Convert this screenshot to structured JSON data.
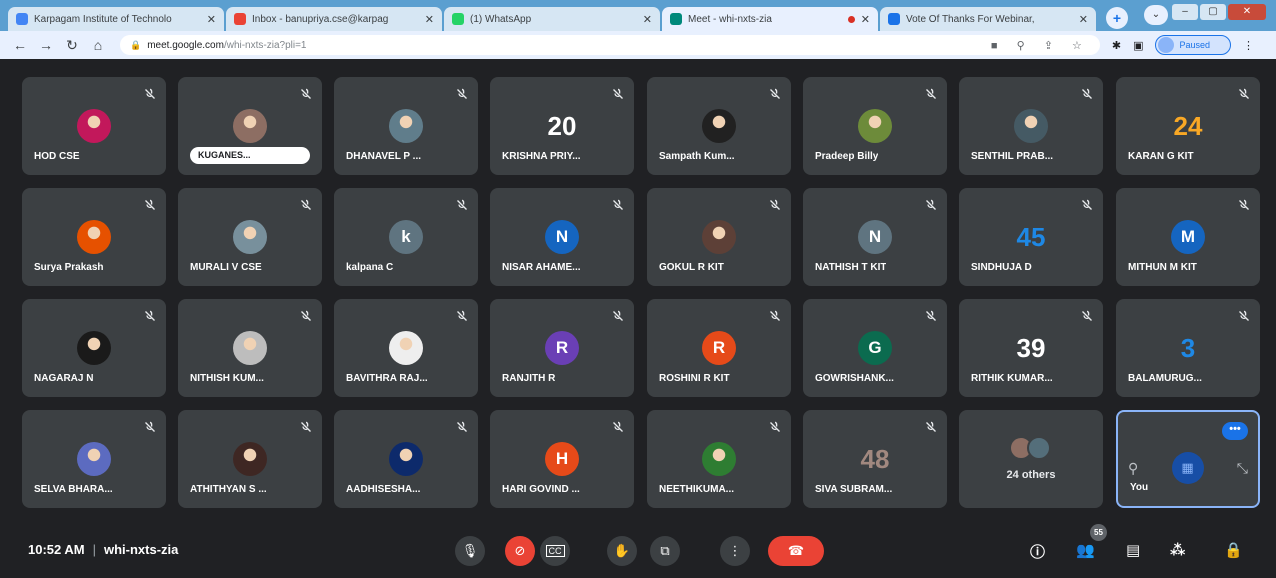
{
  "browser": {
    "tabs": [
      {
        "title": "Karpagam Institute of Technolo",
        "color": "#4285f4",
        "active": false
      },
      {
        "title": "Inbox - banupriya.cse@karpag",
        "color": "#ea4335",
        "active": false
      },
      {
        "title": "(1) WhatsApp",
        "color": "#25d366",
        "active": false
      },
      {
        "title": "Meet - whi-nxts-zia",
        "color": "#00897b",
        "active": true
      },
      {
        "title": "Vote Of Thanks For Webinar, ",
        "color": "#1a73e8",
        "active": false
      }
    ],
    "new_tab": "+",
    "tab_dropdown": "⌄",
    "url_host": "meet.google.com",
    "url_path": "/whi-nxts-zia?pli=1",
    "profile_status": "Paused"
  },
  "meeting": {
    "time": "10:52 AM",
    "code": "whi-nxts-zia",
    "participant_count": "55",
    "others_label": "24 others",
    "self_label": "You"
  },
  "participants": [
    {
      "name": "HOD CSE",
      "avatar": "photo",
      "color": "#c2185b"
    },
    {
      "name": "KUGANES...",
      "avatar": "photo",
      "color": "#8d6e63",
      "pill": true
    },
    {
      "name": "DHANAVEL P ...",
      "avatar": "photo",
      "color": "#607d8b"
    },
    {
      "name": "KRISHNA PRIY...",
      "avatar": "20",
      "color": "#ffffff"
    },
    {
      "name": "Sampath Kum...",
      "avatar": "photo",
      "color": "#212121"
    },
    {
      "name": "Pradeep Billy",
      "avatar": "photo",
      "color": "#6d8b3a"
    },
    {
      "name": "SENTHIL PRAB...",
      "avatar": "photo",
      "color": "#455a64"
    },
    {
      "name": "KARAN G KIT",
      "avatar": "24",
      "color": "#f9a825"
    },
    {
      "name": "Surya Prakash",
      "avatar": "photo",
      "color": "#e65100"
    },
    {
      "name": "MURALI V CSE",
      "avatar": "photo",
      "color": "#78909c"
    },
    {
      "name": "kalpana C",
      "avatar": "k",
      "color": "#5f7480"
    },
    {
      "name": "NISAR AHAME...",
      "avatar": "N",
      "color": "#1565c0"
    },
    {
      "name": "GOKUL R KIT",
      "avatar": "photo",
      "color": "#5d4037"
    },
    {
      "name": "NATHISH T KIT",
      "avatar": "N",
      "color": "#5f7480"
    },
    {
      "name": "SINDHUJA D",
      "avatar": "45",
      "color": "#1e88e5"
    },
    {
      "name": "MITHUN M KIT",
      "avatar": "M",
      "color": "#1565c0"
    },
    {
      "name": "NAGARAJ N",
      "avatar": "photo",
      "color": "#1a1a1a"
    },
    {
      "name": "NITHISH KUM...",
      "avatar": "photo",
      "color": "#bdbdbd"
    },
    {
      "name": "BAVITHRA RAJ...",
      "avatar": "photo",
      "color": "#eeeeee"
    },
    {
      "name": "RANJITH R",
      "avatar": "R",
      "color": "#6a3fb5"
    },
    {
      "name": "ROSHINI R KIT",
      "avatar": "R",
      "color": "#e64a19"
    },
    {
      "name": "GOWRISHANK...",
      "avatar": "G",
      "color": "#0b6b4f"
    },
    {
      "name": "RITHIK KUMAR...",
      "avatar": "39",
      "color": "#ffffff"
    },
    {
      "name": "BALAMURUG...",
      "avatar": "3",
      "color": "#1e88e5"
    },
    {
      "name": "SELVA BHARA...",
      "avatar": "photo",
      "color": "#5c6bc0"
    },
    {
      "name": "ATHITHYAN S ...",
      "avatar": "photo",
      "color": "#3e2723"
    },
    {
      "name": "AADHISESHA...",
      "avatar": "photo",
      "color": "#0d2a6b"
    },
    {
      "name": "HARI GOVIND ...",
      "avatar": "H",
      "color": "#e64a19"
    },
    {
      "name": "NEETHIKUMA...",
      "avatar": "photo",
      "color": "#2e7d32"
    },
    {
      "name": "SIVA SUBRAM...",
      "avatar": "48",
      "color": "#a1887f"
    }
  ],
  "controls": {
    "mic": "microphone-icon",
    "cam": "camera-off-icon",
    "cc": "captions-icon",
    "hand": "raise-hand-icon",
    "present": "present-icon",
    "more": "more-vert-icon",
    "hangup": "hangup-icon"
  }
}
